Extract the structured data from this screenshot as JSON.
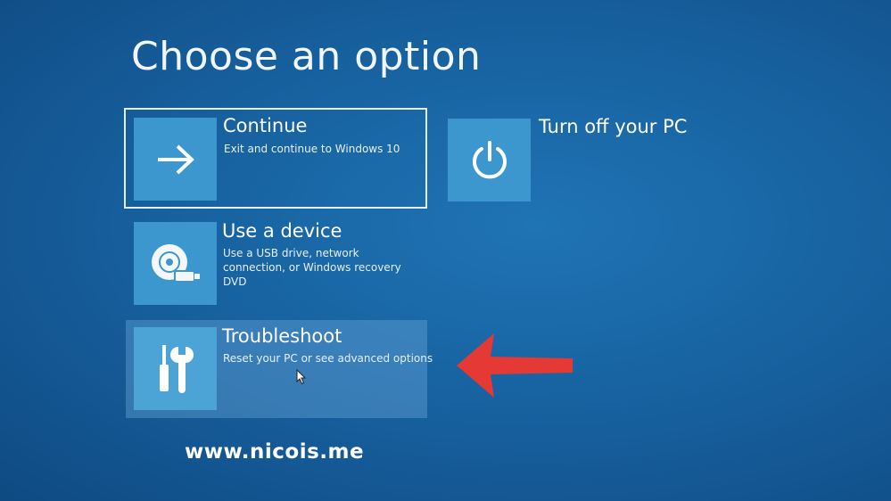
{
  "page": {
    "title": "Choose an option",
    "background_color": "#165e9c",
    "tile_color": "#3c97cf"
  },
  "options": [
    {
      "id": "continue",
      "label": "Continue",
      "description": "Exit and continue to Windows 10",
      "icon": "arrow-right-icon",
      "selected": true
    },
    {
      "id": "use-device",
      "label": "Use a device",
      "description": "Use a USB drive, network connection, or Windows recovery DVD",
      "icon": "disc-icon"
    },
    {
      "id": "troubleshoot",
      "label": "Troubleshoot",
      "description": "Reset your PC or see advanced options",
      "icon": "tools-icon",
      "hovered": true
    },
    {
      "id": "turn-off",
      "label": "Turn off your PC",
      "icon": "power-icon"
    }
  ],
  "annotation": {
    "arrow_color": "#e53935",
    "icon": "red-arrow-icon"
  },
  "watermark": {
    "text": "www.nicois.me"
  }
}
